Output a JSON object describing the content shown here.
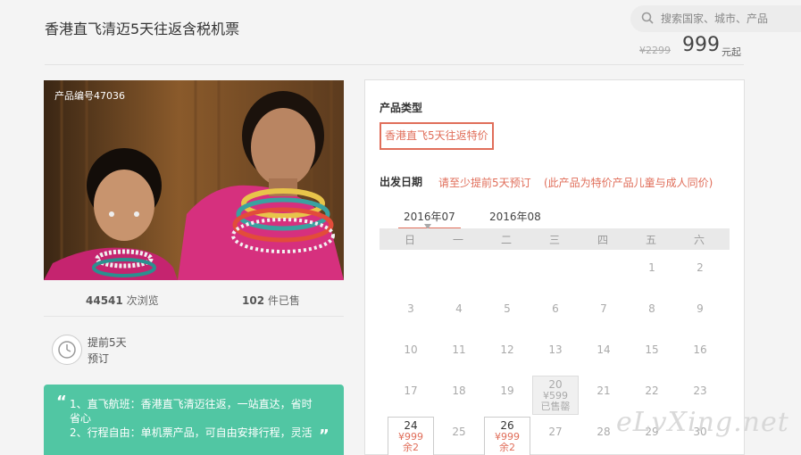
{
  "header": {
    "title": "香港直飞清迈5天往返含税机票",
    "search_placeholder": "搜索国家、城市、产品",
    "price_old": "¥2299",
    "price_now": "999",
    "price_unit": "元起"
  },
  "product": {
    "id_label": "产品编号47036",
    "views_count": "44541",
    "views_label": "次浏览",
    "sold_count": "102",
    "sold_label": "件已售",
    "advance_line1": "提前5天",
    "advance_line2": "预订",
    "highlight_line1": "1、直飞航班：香港直飞清迈往返，一站直达，省时省心",
    "highlight_line2": "2、行程自由：单机票产品，可自由安排行程，灵活"
  },
  "panel": {
    "type_title": "产品类型",
    "type_option": "香港直飞5天往返特价",
    "date_title": "出发日期",
    "date_note1": "请至少提前5天预订",
    "date_note2": "(此产品为特价产品儿童与成人同价)",
    "month_tabs": [
      "2016年07",
      "2016年08"
    ],
    "weekdays": [
      "日",
      "一",
      "二",
      "三",
      "四",
      "五",
      "六"
    ],
    "days": [
      "1",
      "2",
      "3",
      "4",
      "5",
      "6",
      "7",
      "8",
      "9",
      "10",
      "11",
      "12",
      "13",
      "14",
      "15",
      "16",
      "17",
      "18",
      "19",
      "20",
      "21",
      "22",
      "23",
      "24",
      "25",
      "26",
      "27",
      "28",
      "29",
      "30"
    ],
    "sold_price": "¥599",
    "sold_label": "已售罄",
    "avail_price": "¥999",
    "avail_left": "余2"
  },
  "watermark": "eLvXing.net",
  "colors": {
    "accent": "#e06e5a",
    "green": "#51c6a3"
  },
  "icons": {
    "search": "search-icon",
    "clock": "clock-icon"
  }
}
